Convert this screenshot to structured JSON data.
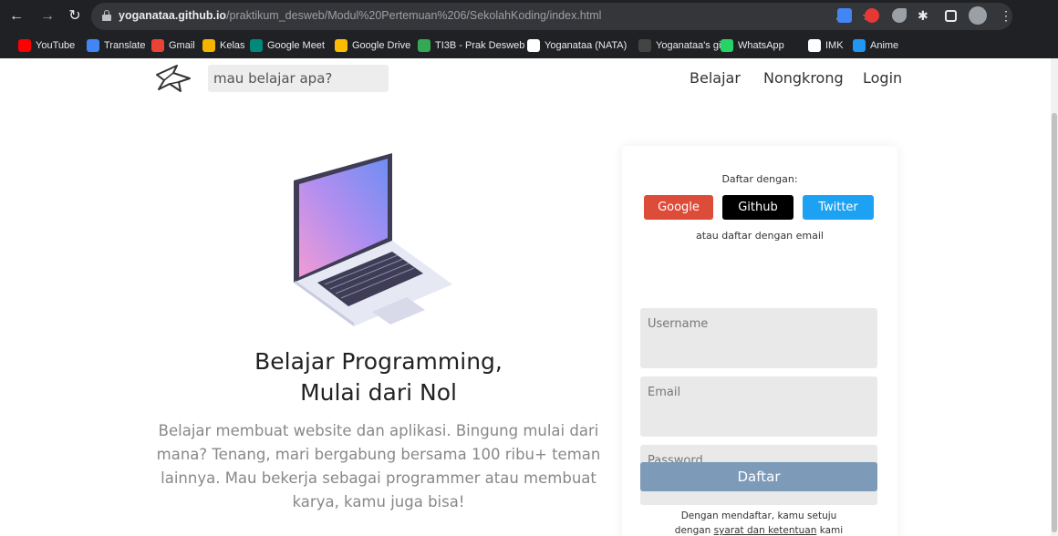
{
  "browser": {
    "url_host": "yoganataa.github.io",
    "url_path": "/praktikum_desweb/Modul%20Pertemuan%206/SekolahKoding/index.html",
    "bookmarks": [
      {
        "label": "YouTube",
        "color": "#ff0000"
      },
      {
        "label": "Translate",
        "color": "#4285f4"
      },
      {
        "label": "Gmail",
        "color": "#ea4335"
      },
      {
        "label": "Kelas",
        "color": "#f4b400"
      },
      {
        "label": "Google Meet",
        "color": "#00897b"
      },
      {
        "label": "Google Drive",
        "color": "#fbbc04"
      },
      {
        "label": "TI3B - Prak Desweb",
        "color": "#34a853"
      },
      {
        "label": "Yoganataa (NATA)",
        "color": "#ffffff"
      },
      {
        "label": "Yoganataa's gists",
        "color": "#444444"
      },
      {
        "label": "WhatsApp",
        "color": "#25d366"
      },
      {
        "label": "IMK",
        "color": "#ffffff"
      },
      {
        "label": "Anime",
        "color": "#2196f3"
      }
    ]
  },
  "header": {
    "search_placeholder": "mau belajar apa?",
    "nav": [
      "Belajar",
      "Nongkrong",
      "Login"
    ]
  },
  "hero": {
    "title_line1": "Belajar Programming,",
    "title_line2": "Mulai dari Nol",
    "description": "Belajar membuat website dan aplikasi. Bingung mulai dari mana? Tenang, mari bergabung bersama 100 ribu+ teman lainnya. Mau bekerja sebagai programmer atau membuat karya, kamu juga bisa!"
  },
  "signup": {
    "heading": "Daftar dengan:",
    "social": [
      {
        "label": "Google",
        "color": "#dd4b39"
      },
      {
        "label": "Github",
        "color": "#000000"
      },
      {
        "label": "Twitter",
        "color": "#1da1f2"
      }
    ],
    "alt_text": "atau daftar dengan email",
    "fields": [
      "Username",
      "Email",
      "Password"
    ],
    "submit_label": "Daftar",
    "terms_line1": "Dengan mendaftar, kamu setuju",
    "terms_prefix": "dengan ",
    "terms_link": "syarat dan ketentuan",
    "terms_suffix": " kami"
  }
}
